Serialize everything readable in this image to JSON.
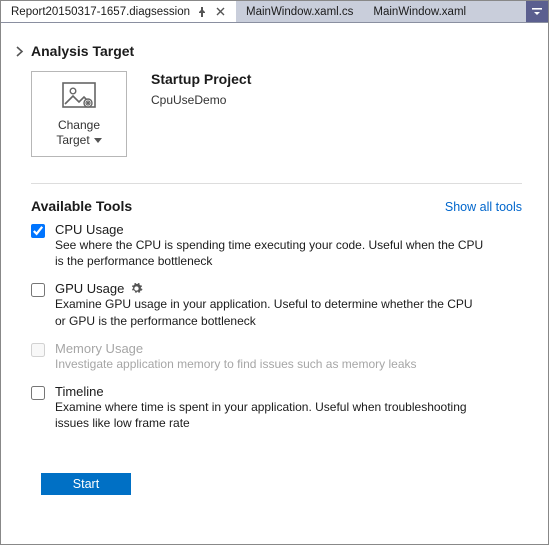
{
  "tabs": {
    "active": {
      "label": "Report20150317-1657.diagsession"
    },
    "others": [
      {
        "label": "MainWindow.xaml.cs"
      },
      {
        "label": "MainWindow.xaml"
      }
    ]
  },
  "analysis_target": {
    "heading": "Analysis Target",
    "change_button_line1": "Change",
    "change_button_line2": "Target",
    "target_title": "Startup Project",
    "target_name": "CpuUseDemo"
  },
  "available_tools": {
    "heading": "Available Tools",
    "show_all": "Show all tools",
    "tools": [
      {
        "name": "CPU Usage",
        "desc": "See where the CPU is spending time executing your code. Useful when the CPU is the performance bottleneck",
        "checked": true,
        "enabled": true,
        "gear": false
      },
      {
        "name": "GPU Usage",
        "desc": "Examine GPU usage in your application. Useful to determine whether the CPU or GPU is the performance bottleneck",
        "checked": false,
        "enabled": true,
        "gear": true
      },
      {
        "name": "Memory Usage",
        "desc": "Investigate application memory to find issues such as memory leaks",
        "checked": false,
        "enabled": false,
        "gear": false
      },
      {
        "name": "Timeline",
        "desc": "Examine where time is spent in your application. Useful when troubleshooting issues like low frame rate",
        "checked": false,
        "enabled": true,
        "gear": false
      }
    ]
  },
  "footer": {
    "start": "Start"
  }
}
